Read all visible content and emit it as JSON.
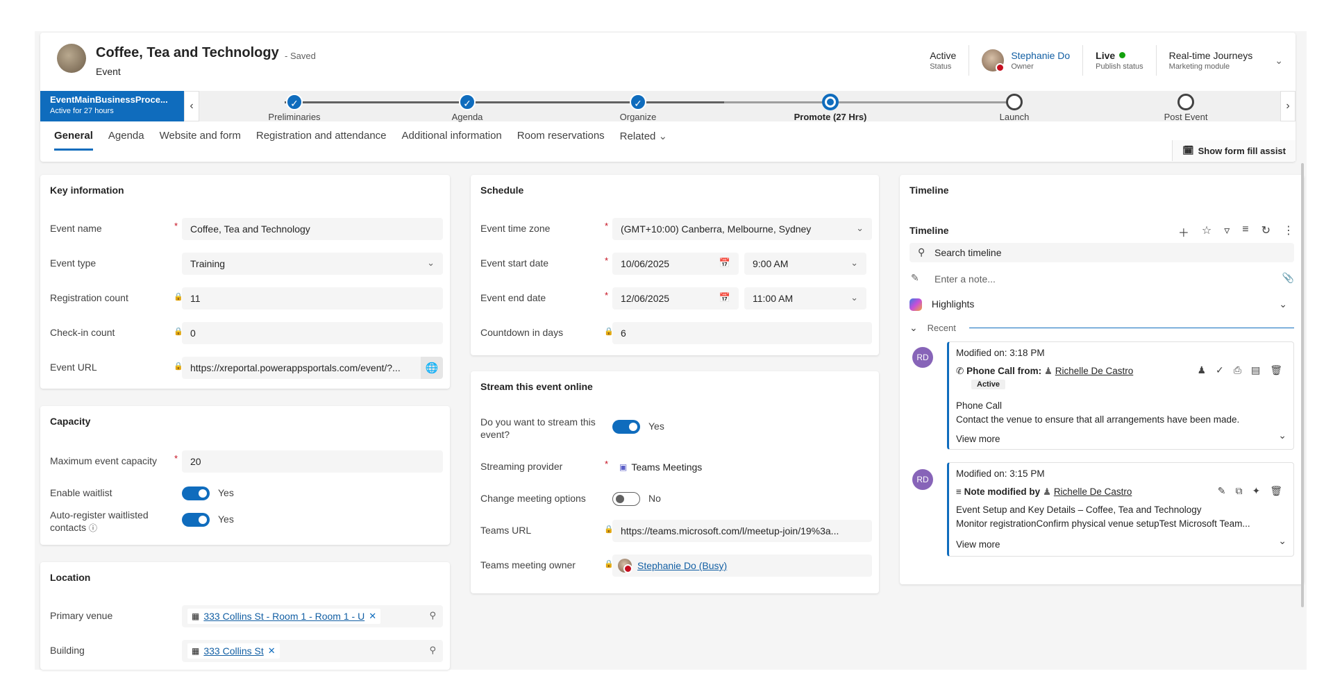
{
  "header": {
    "title": "Coffee, Tea and Technology",
    "saved": "- Saved",
    "entity": "Event",
    "status_value": "Active",
    "status_label": "Status",
    "owner_name": "Stephanie Do",
    "owner_label": "Owner",
    "publish_value": "Live",
    "publish_label": "Publish status",
    "module_value": "Real-time Journeys",
    "module_label": "Marketing module"
  },
  "bpf": {
    "active_name": "EventMainBusinessProce...",
    "active_sub": "Active for 27 hours",
    "stages": [
      "Preliminaries",
      "Agenda",
      "Organize",
      "Promote  (27 Hrs)",
      "Launch",
      "Post Event"
    ]
  },
  "tabs": [
    "General",
    "Agenda",
    "Website and form",
    "Registration and attendance",
    "Additional information",
    "Room reservations",
    "Related"
  ],
  "form_fill_assist": "Show form fill assist",
  "key_info": {
    "title": "Key information",
    "event_name_label": "Event name",
    "event_name": "Coffee, Tea and Technology",
    "event_type_label": "Event type",
    "event_type": "Training",
    "reg_count_label": "Registration count",
    "reg_count": "11",
    "checkin_label": "Check-in count",
    "checkin": "0",
    "url_label": "Event URL",
    "url": "https://xreportal.powerappsportals.com/event/?..."
  },
  "capacity": {
    "title": "Capacity",
    "max_label": "Maximum event capacity",
    "max": "20",
    "waitlist_label": "Enable waitlist",
    "waitlist": "Yes",
    "auto_label": "Auto-register waitlisted contacts",
    "auto": "Yes"
  },
  "location": {
    "title": "Location",
    "venue_label": "Primary venue",
    "venue": "333 Collins St - Room 1 - Room 1 - U",
    "building_label": "Building",
    "building": "333 Collins St"
  },
  "schedule": {
    "title": "Schedule",
    "tz_label": "Event time zone",
    "tz": "(GMT+10:00) Canberra, Melbourne, Sydney",
    "start_label": "Event start date",
    "start_date": "10/06/2025",
    "start_time": "9:00 AM",
    "end_label": "Event end date",
    "end_date": "12/06/2025",
    "end_time": "11:00 AM",
    "countdown_label": "Countdown in days",
    "countdown": "6"
  },
  "stream": {
    "title": "Stream this event online",
    "q_label": "Do you want to stream this event?",
    "q": "Yes",
    "provider_label": "Streaming provider",
    "provider": "Teams Meetings",
    "change_label": "Change meeting options",
    "change": "No",
    "url_label": "Teams URL",
    "url": "https://teams.microsoft.com/l/meetup-join/19%3a...",
    "owner_label": "Teams meeting owner",
    "owner": "Stephanie Do (Busy)"
  },
  "timeline": {
    "card_title": "Timeline",
    "title": "Timeline",
    "search": "Search timeline",
    "note": "Enter a note...",
    "highlights": "Highlights",
    "recent": "Recent",
    "a1_initials": "RD",
    "a1_modified": "Modified on: 3:18 PM",
    "a1_type": "Phone Call from:",
    "a1_person": "Richelle De Castro",
    "a1_badge": "Active",
    "a1_subject": "Phone Call",
    "a1_body": "Contact the venue to ensure that all arrangements have been made.",
    "a1_more": "View more",
    "a2_initials": "RD",
    "a2_modified": "Modified on: 3:15 PM",
    "a2_type": "Note modified by",
    "a2_person": "Richelle De Castro",
    "a2_subject": "Event Setup and Key Details – Coffee, Tea and Technology",
    "a2_body": "Monitor registrationConfirm physical venue setupTest Microsoft Team...",
    "a2_more": "View more"
  }
}
